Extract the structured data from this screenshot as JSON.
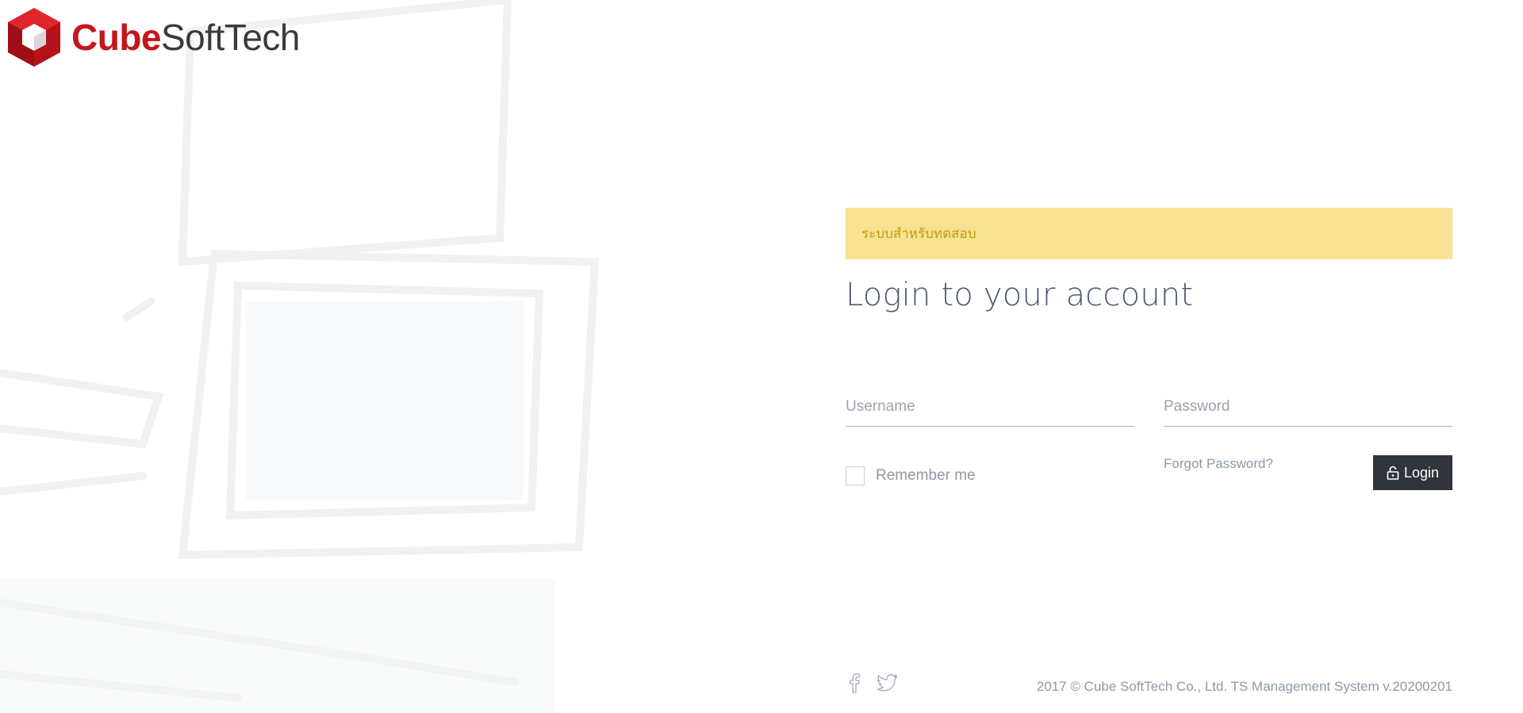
{
  "brand": {
    "name_part1": "Cube",
    "name_part2": "SoftTech",
    "accent_color": "#c4161c"
  },
  "alert": {
    "text": "ระบบสำหรับทดสอบ",
    "background": "#f7e293",
    "color": "#c29d0b"
  },
  "form": {
    "title": "Login to your account",
    "username_placeholder": "Username",
    "username_value": "",
    "password_placeholder": "Password",
    "password_value": "",
    "remember_label": "Remember me",
    "remember_checked": false,
    "forgot_label": "Forgot Password?",
    "login_label": "Login",
    "login_icon": "lock-icon"
  },
  "footer": {
    "social_icons": [
      "facebook-icon",
      "twitter-icon"
    ],
    "copyright": "2017 © Cube SoftTech Co., Ltd. TS Management System v.20200201"
  }
}
